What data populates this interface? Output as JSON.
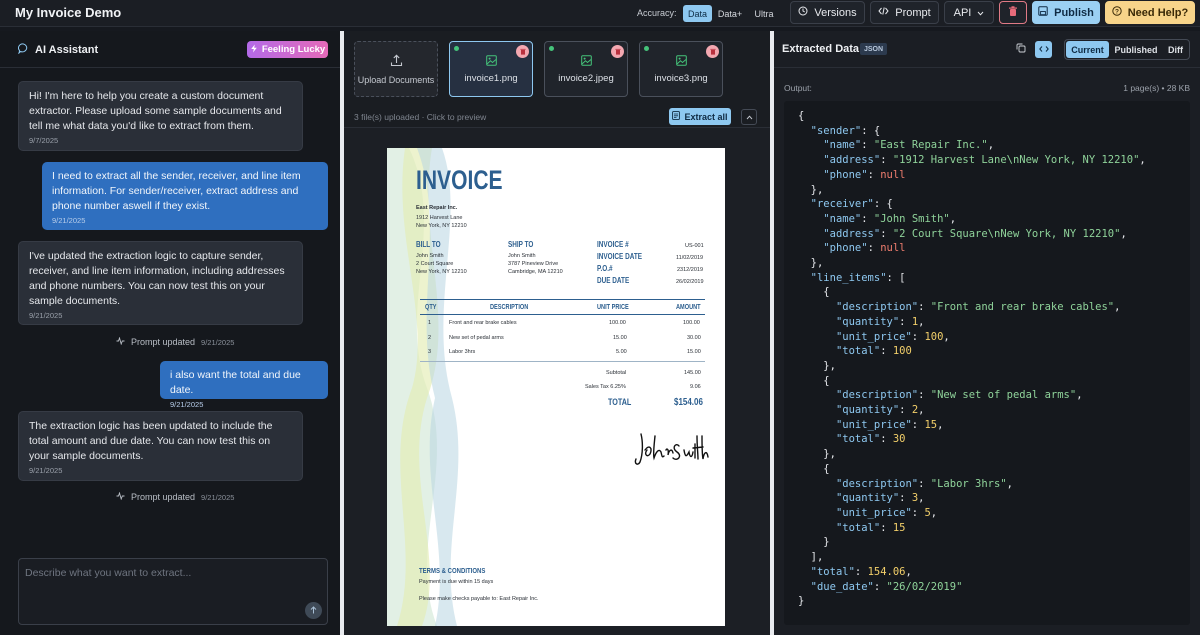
{
  "app": {
    "title": "My Invoice Demo"
  },
  "topbar": {
    "accuracy_label": "Accuracy:",
    "accuracy_options": [
      "Data",
      "Data+",
      "Ultra"
    ],
    "accuracy_selected": "Data",
    "versions_label": "Versions",
    "prompt_label": "Prompt",
    "api_label": "API",
    "publish_label": "Publish",
    "help_label": "Need Help?"
  },
  "assistant": {
    "title": "AI Assistant",
    "lucky_label": "Feeling Lucky",
    "messages": [
      {
        "role": "ai",
        "text": "Hi! I'm here to help you create a custom document extractor. Please upload some sample documents and tell me what data you'd like to extract from them.",
        "ts": "9/7/2025"
      },
      {
        "role": "user",
        "text": "I need to extract all the sender, receiver, and line item information. For sender/receiver, extract address and phone number aswell if they exist.",
        "ts": "9/21/2025"
      },
      {
        "role": "ai",
        "text": "I've updated the extraction logic to capture sender, receiver, and line item information, including addresses and phone numbers. You can now test this on your sample documents.",
        "ts": "9/21/2025"
      },
      {
        "role": "system",
        "text": "Prompt updated",
        "ts": "9/21/2025"
      },
      {
        "role": "user",
        "text": "i also want the total and due date.",
        "ts": "9/21/2025"
      },
      {
        "role": "ai",
        "text": "The extraction logic has been updated to include the total amount and due date. You can now test this on your sample documents.",
        "ts": "9/21/2025"
      },
      {
        "role": "system",
        "text": "Prompt updated",
        "ts": "9/21/2025"
      }
    ],
    "input_placeholder": "Describe what you want to extract..."
  },
  "files": {
    "upload_label": "Upload Documents",
    "items": [
      {
        "name": "invoice1.png",
        "selected": true
      },
      {
        "name": "invoice2.jpeg",
        "selected": false
      },
      {
        "name": "invoice3.png",
        "selected": false
      }
    ],
    "status": "3 file(s) uploaded · Click to preview",
    "extract_all_label": "Extract all"
  },
  "invoice": {
    "title": "INVOICE",
    "from_name": "East Repair Inc.",
    "from_addr1": "1912 Harvest Lane",
    "from_addr2": "New York, NY 12210",
    "bill_to_label": "BILL TO",
    "bill_to": [
      "John Smith",
      "2 Court Square",
      "New York, NY 12210"
    ],
    "ship_to_label": "SHIP TO",
    "ship_to": [
      "John Smith",
      "3787 Pineview Drive",
      "Cambridge, MA 12210"
    ],
    "meta": [
      {
        "label": "INVOICE #",
        "value": "US-001"
      },
      {
        "label": "INVOICE DATE",
        "value": "11/02/2019"
      },
      {
        "label": "P.O.#",
        "value": "2312/2019"
      },
      {
        "label": "DUE DATE",
        "value": "26/02/2019"
      }
    ],
    "headers": {
      "qty": "QTY",
      "desc": "DESCRIPTION",
      "price": "UNIT PRICE",
      "amount": "AMOUNT"
    },
    "rows": [
      {
        "qty": "1",
        "desc": "Front and rear brake cables",
        "price": "100.00",
        "amount": "100.00"
      },
      {
        "qty": "2",
        "desc": "New set of pedal arms",
        "price": "15.00",
        "amount": "30.00"
      },
      {
        "qty": "3",
        "desc": "Labor 3hrs",
        "price": "5.00",
        "amount": "15.00"
      }
    ],
    "subtotal_label": "Subtotal",
    "subtotal": "145.00",
    "tax_label": "Sales Tax 6.25%",
    "tax": "9.06",
    "total_label": "TOTAL",
    "total": "$154.06",
    "terms_label": "TERMS & CONDITIONS",
    "terms_line1": "Payment is due within 15 days",
    "terms_line2": "Please make checks payable to: East Repair Inc."
  },
  "extracted": {
    "title": "Extracted Data",
    "badge": "JSON",
    "tabs": [
      "Current",
      "Published",
      "Diff"
    ],
    "active_tab": "Current",
    "output_label": "Output:",
    "meta": "1 page(s) • 28 KB"
  },
  "colors": {
    "accent": "#8ec8f0",
    "user_bubble": "#2f6fbf",
    "publish": "#9bd0f3",
    "help": "#f7d48a",
    "invoice_blue": "#2d5f8f"
  }
}
